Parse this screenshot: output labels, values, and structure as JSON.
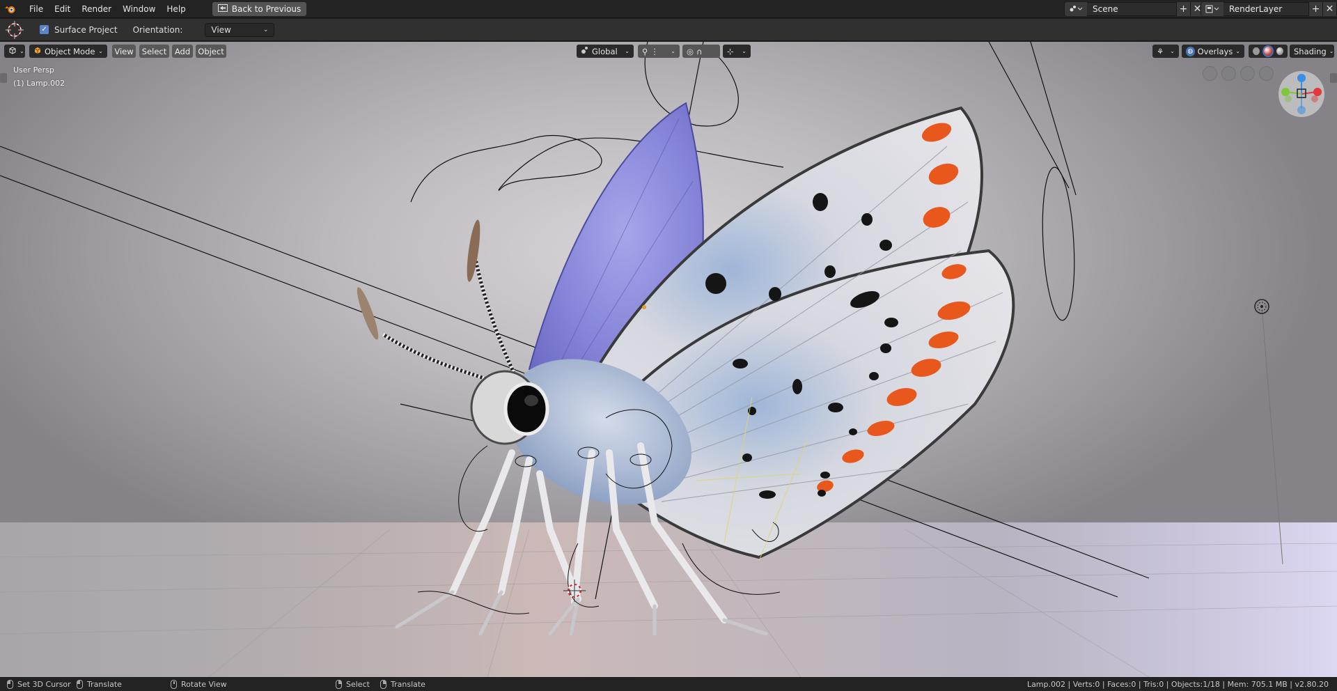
{
  "menu": {
    "items": [
      "File",
      "Edit",
      "Render",
      "Window",
      "Help"
    ],
    "back_button": "Back to Previous"
  },
  "scene": {
    "name": "Scene"
  },
  "render_layer": {
    "name": "RenderLayer"
  },
  "tool_settings": {
    "surface_project_label": "Surface Project",
    "surface_project_checked": true,
    "orientation_label": "Orientation:",
    "orientation_value": "View"
  },
  "viewport_header": {
    "mode": "Object Mode",
    "menus": [
      "View",
      "Select",
      "Add",
      "Object"
    ],
    "transform_orientation": "Global",
    "overlays_label": "Overlays",
    "shading_label": "Shading"
  },
  "viewport_info": {
    "view_name": "User Persp",
    "active_object": "(1) Lamp.002"
  },
  "status_bar": {
    "left_click": "Set 3D Cursor",
    "left_drag": "Translate",
    "middle": "Rotate View",
    "right_click": "Select",
    "right_drag": "Translate",
    "stats": "Lamp.002 | Verts:0 | Faces:0 | Tris:0 | Objects:1/18 | Mem: 705.1 MB | v2.80.20"
  },
  "colors": {
    "accent": "#5b84c6",
    "gizmo_x": "#e23a3a",
    "gizmo_y": "#7ec83c",
    "gizmo_z": "#3a8fe2"
  },
  "icons": [
    "blender-logo-icon",
    "back-icon",
    "scene-icon",
    "renderlayer-icon",
    "cursor-tool-icon",
    "editor-type-icon",
    "object-mode-icon",
    "orientation-icon",
    "snap-icon",
    "proportional-icon",
    "pivot-icon",
    "visibility-icon",
    "overlays-icon",
    "shading-solid-icon",
    "shading-material-icon",
    "shading-rendered-icon",
    "zoom-icon",
    "pan-icon",
    "camera-view-icon",
    "perspective-icon",
    "navigation-gizmo-icon"
  ]
}
